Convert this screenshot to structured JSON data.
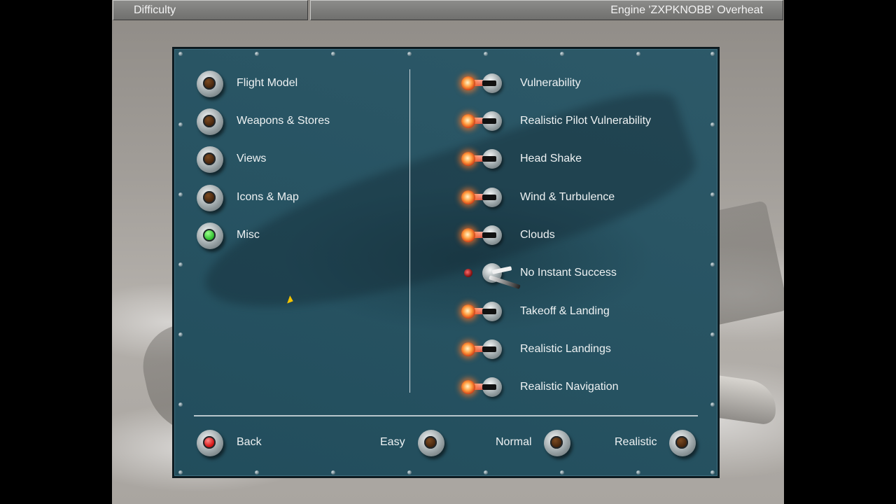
{
  "topbar": {
    "left_title": "Difficulty",
    "right_status": "Engine 'ZXPKNOBB' Overheat"
  },
  "left_menu": {
    "items": [
      {
        "label": "Flight Model",
        "state": "inactive"
      },
      {
        "label": "Weapons & Stores",
        "state": "inactive"
      },
      {
        "label": "Views",
        "state": "inactive"
      },
      {
        "label": "Icons & Map",
        "state": "inactive"
      },
      {
        "label": "Misc",
        "state": "active"
      }
    ]
  },
  "options": {
    "items": [
      {
        "label": "Vulnerability",
        "enabled": true
      },
      {
        "label": "Realistic Pilot Vulnerability",
        "enabled": true
      },
      {
        "label": "Head Shake",
        "enabled": true
      },
      {
        "label": "Wind & Turbulence",
        "enabled": true
      },
      {
        "label": "Clouds",
        "enabled": true
      },
      {
        "label": "No Instant Success",
        "enabled": false
      },
      {
        "label": "Takeoff & Landing",
        "enabled": true
      },
      {
        "label": "Realistic Landings",
        "enabled": true
      },
      {
        "label": "Realistic Navigation",
        "enabled": true
      }
    ]
  },
  "footer": {
    "back_label": "Back",
    "easy_label": "Easy",
    "normal_label": "Normal",
    "realistic_label": "Realistic"
  },
  "colors": {
    "panel": "#245262",
    "lamp_on": "#ff9a3c",
    "knob_active": "#2fbf2f",
    "back_knob": "#d41313"
  }
}
